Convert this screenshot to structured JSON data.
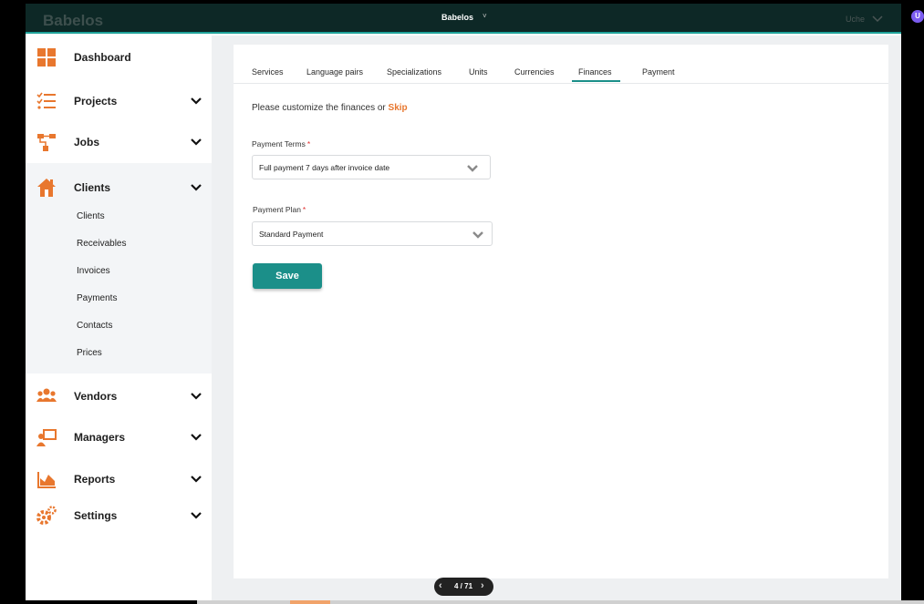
{
  "topbar": {
    "brand": "Babelos",
    "center_title": "Babelos",
    "center_caret": "˅",
    "user_name": "Uche",
    "avatar_initial": "U"
  },
  "colors": {
    "accent_orange": "#e8772e",
    "teal": "#1b8f89",
    "topbar_bg": "#0d2826"
  },
  "sidebar": {
    "items": [
      {
        "label": "Dashboard",
        "icon": "dashboard-grid-icon"
      },
      {
        "label": "Projects",
        "icon": "checklist-icon"
      },
      {
        "label": "Jobs",
        "icon": "workflow-icon"
      },
      {
        "label": "Clients",
        "icon": "house-icon"
      },
      {
        "label": "Vendors",
        "icon": "people-group-icon"
      },
      {
        "label": "Managers",
        "icon": "presenter-board-icon"
      },
      {
        "label": "Reports",
        "icon": "area-chart-icon"
      },
      {
        "label": "Settings",
        "icon": "gears-icon"
      }
    ],
    "clients_sub": [
      "Clients",
      "Receivables",
      "Invoices",
      "Payments",
      "Contacts",
      "Prices"
    ]
  },
  "tabs": [
    "Services",
    "Language pairs",
    "Specializations",
    "Units",
    "Currencies",
    "Finances",
    "Payment"
  ],
  "active_tab": "Finances",
  "form": {
    "intro_text": "Please customize the finances or",
    "skip_label": "Skip",
    "payment_terms_label": "Payment Terms",
    "payment_terms_value": "Full payment 7 days after invoice date",
    "payment_plan_label": "Payment Plan",
    "payment_plan_value": "Standard Payment",
    "required_mark": "*",
    "save_label": "Save"
  },
  "pager": {
    "text": "4 / 71",
    "prev": "‹",
    "next": "›"
  }
}
